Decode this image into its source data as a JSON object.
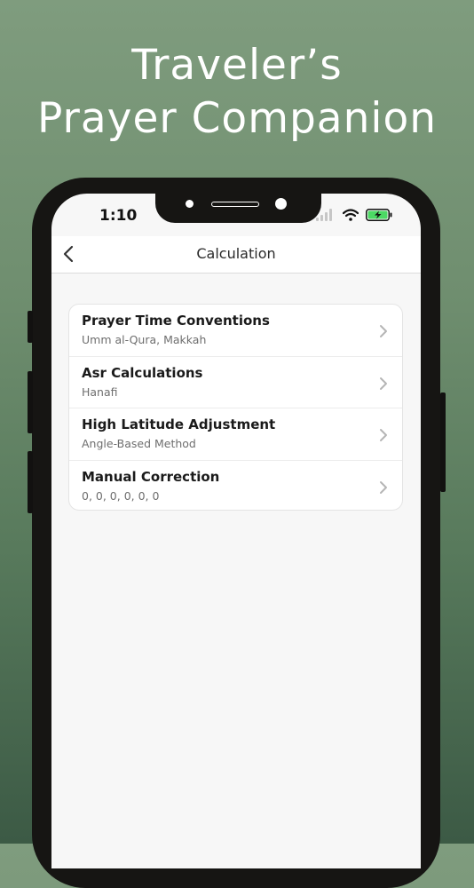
{
  "headline": {
    "line1": "Traveler’s",
    "line2": "Prayer Companion"
  },
  "status_bar": {
    "time": "1:10"
  },
  "navbar": {
    "title": "Calculation"
  },
  "settings": [
    {
      "title": "Prayer Time Conventions",
      "subtitle": "Umm al-Qura, Makkah"
    },
    {
      "title": "Asr Calculations",
      "subtitle": "Hanafi"
    },
    {
      "title": "High Latitude Adjustment",
      "subtitle": "Angle-Based Method"
    },
    {
      "title": "Manual Correction",
      "subtitle": "0, 0, 0, 0, 0, 0"
    }
  ],
  "icons": {
    "back": "chevron-left-icon",
    "row_chevron": "chevron-right-icon",
    "signal": "cellular-signal-icon",
    "wifi": "wifi-icon",
    "battery": "battery-charging-icon"
  },
  "colors": {
    "background_top": "#7f9c7e",
    "background_bottom": "#3c5a45",
    "battery_fill": "#4cd964"
  }
}
